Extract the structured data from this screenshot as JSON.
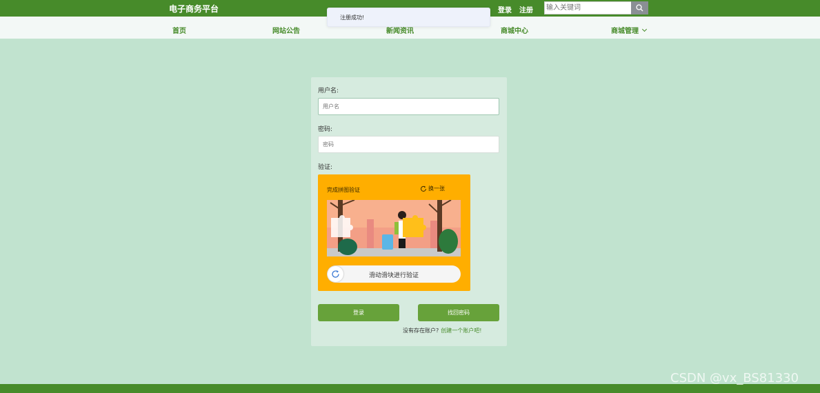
{
  "header": {
    "brand": "电子商务平台",
    "login": "登录",
    "register": "注册",
    "search_placeholder": "输入关键词",
    "search_icon": "search-icon"
  },
  "nav": {
    "items": [
      "首页",
      "网站公告",
      "新闻资讯",
      "商城中心",
      "商城管理"
    ]
  },
  "toast": {
    "message": "注册成功!"
  },
  "form": {
    "username_label": "用户名:",
    "username_placeholder": "用户名",
    "password_label": "密码:",
    "password_placeholder": "密码",
    "verify_label": "验证:",
    "captcha": {
      "title": "完成拼图验证",
      "refresh_label": "换一张",
      "slider_text": "滑动滑块进行验证"
    },
    "login_button": "登录",
    "forgot_button": "找回密码",
    "no_account_text": "没有存在账户?",
    "create_account_link": "创建一个账户吧!"
  },
  "watermark": "CSDN @vx_BS81330",
  "colors": {
    "primary": "#478b2a",
    "button": "#67a23a",
    "background": "#c1e3cf",
    "captcha_bg": "#ffae00"
  }
}
